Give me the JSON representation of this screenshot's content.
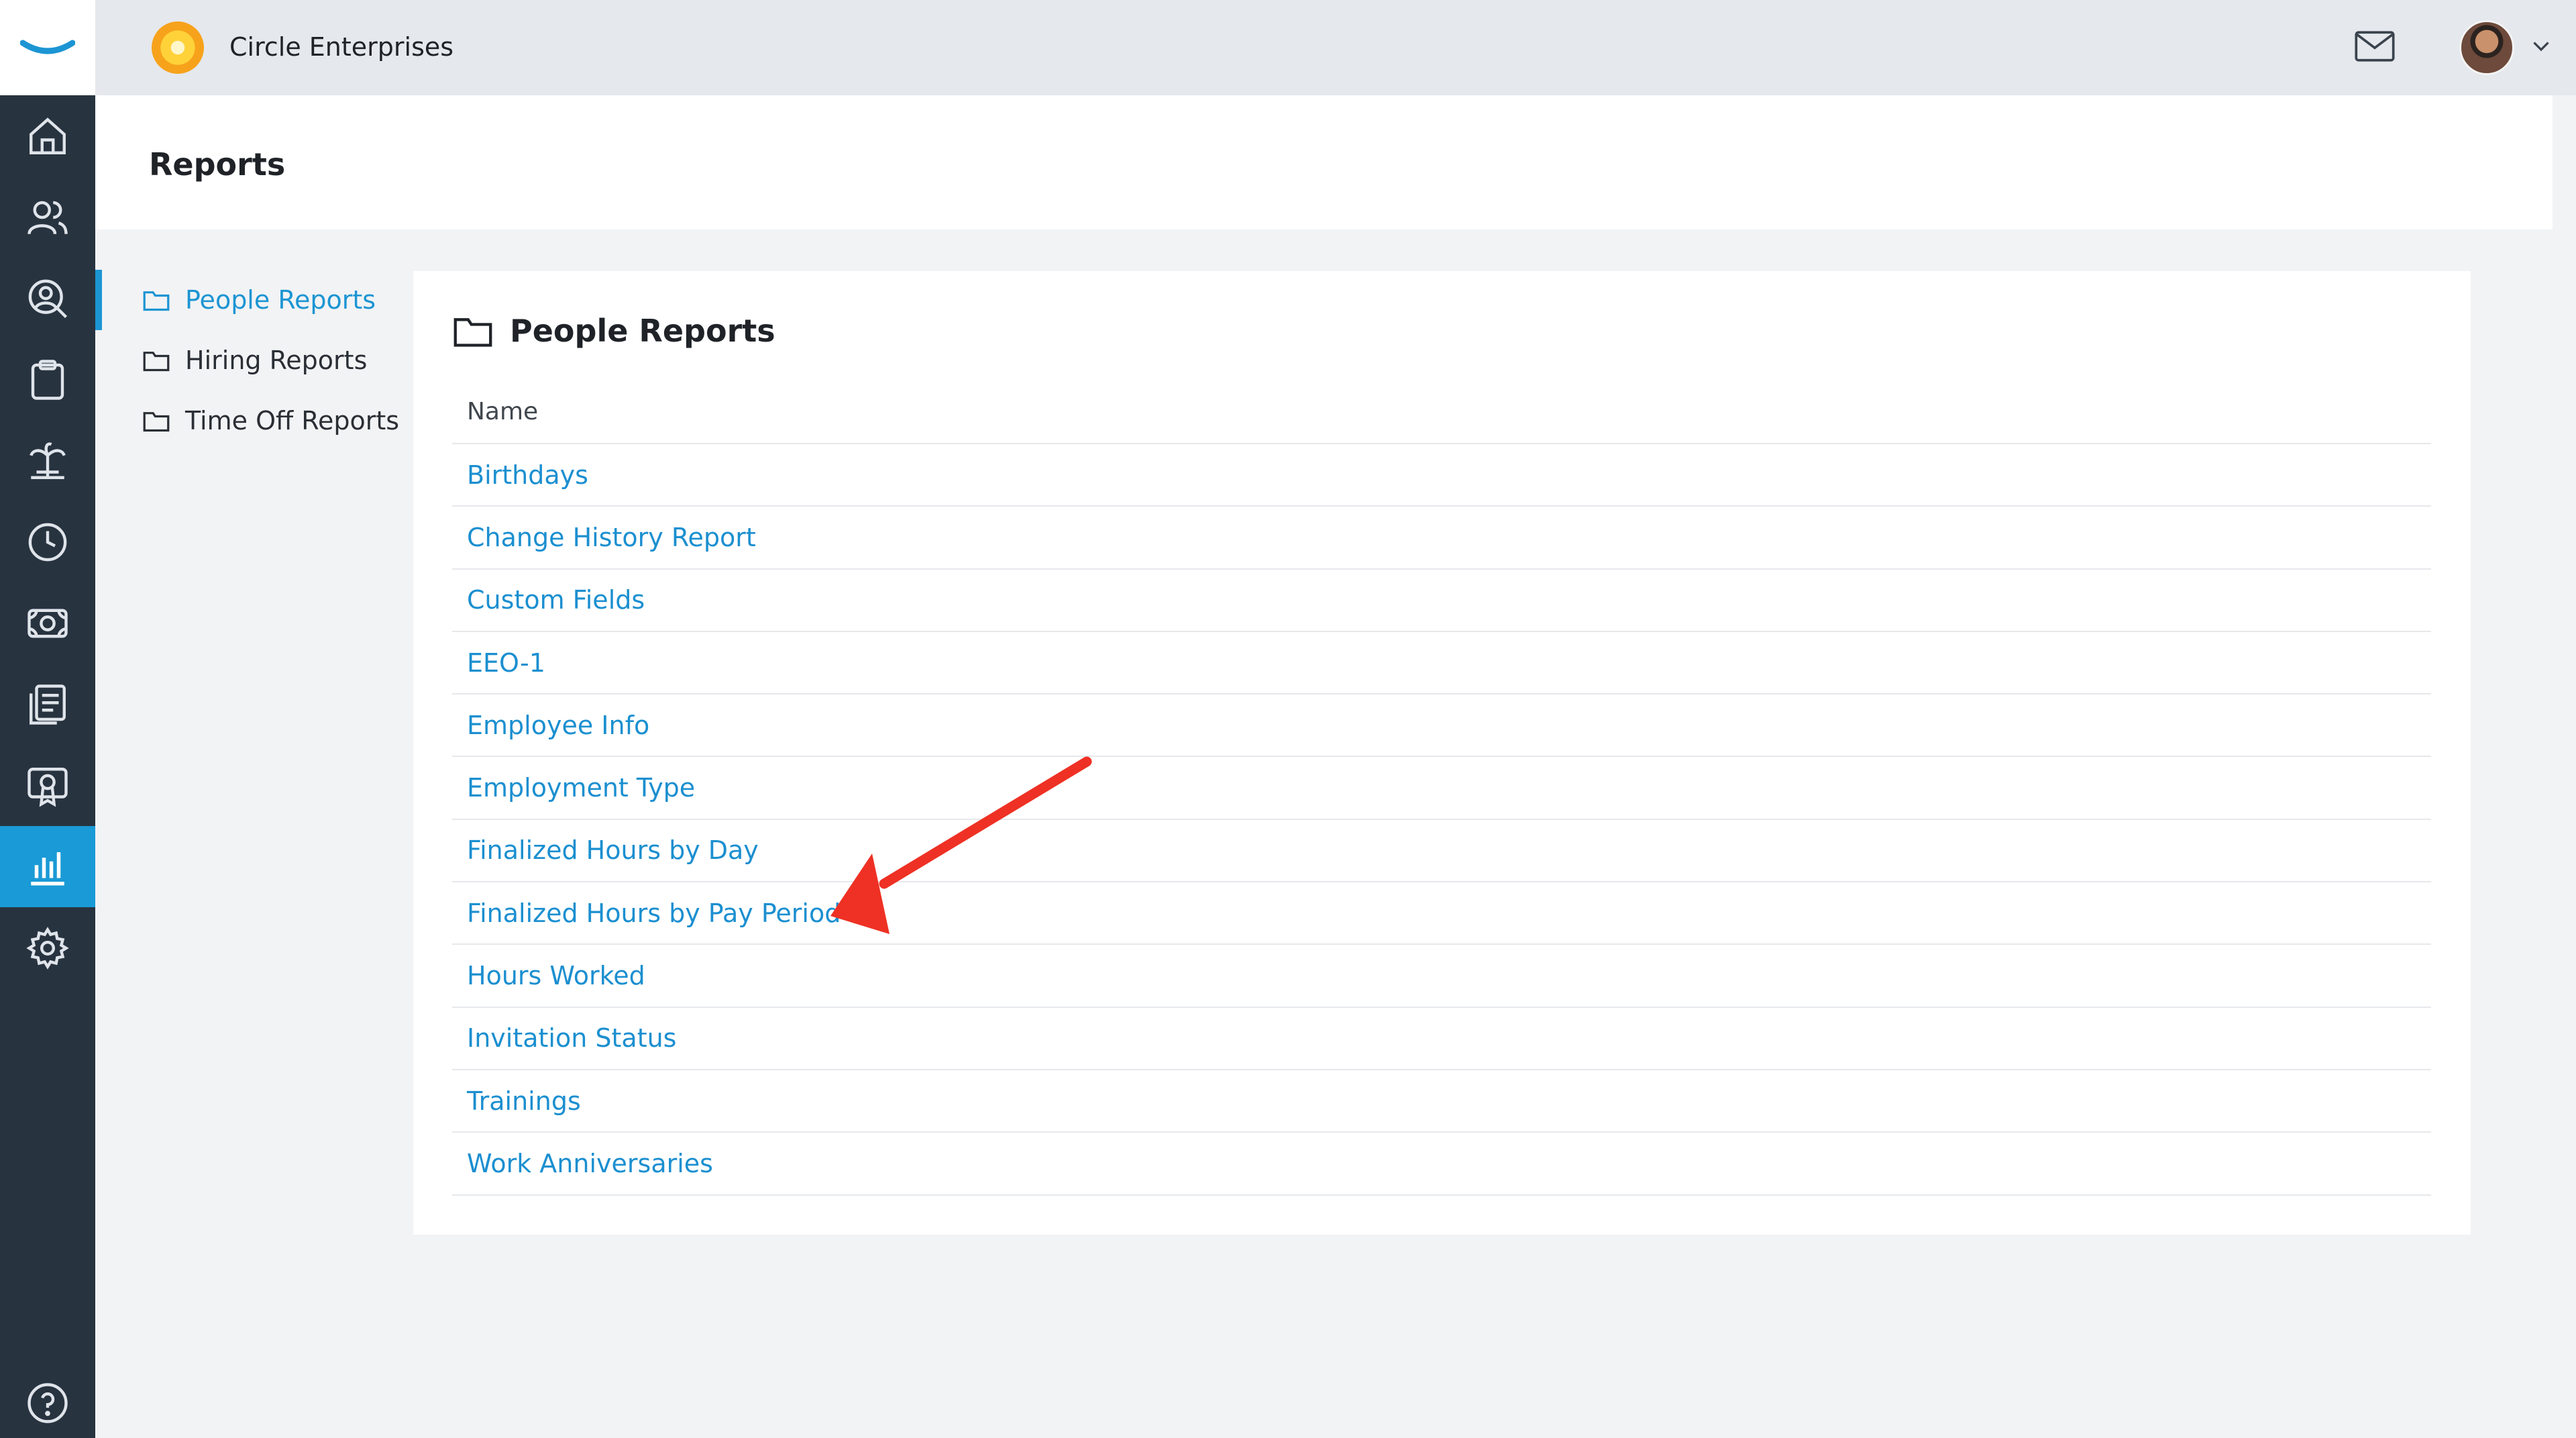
{
  "app": {
    "company_name": "Circle Enterprises",
    "accent_color": "#1c95d3"
  },
  "rail": {
    "items": [
      {
        "icon": "home-icon"
      },
      {
        "icon": "people-icon"
      },
      {
        "icon": "user-search-icon"
      },
      {
        "icon": "clipboard-icon"
      },
      {
        "icon": "vacation-icon"
      },
      {
        "icon": "clock-icon"
      },
      {
        "icon": "money-icon"
      },
      {
        "icon": "documents-icon"
      },
      {
        "icon": "certificate-icon"
      },
      {
        "icon": "reports-chart-icon",
        "active": true
      },
      {
        "icon": "gear-icon"
      }
    ],
    "help_icon": "help-circle-icon"
  },
  "header": {
    "title": "Reports"
  },
  "left_nav": {
    "items": [
      {
        "label": "People Reports",
        "active": true
      },
      {
        "label": "Hiring Reports"
      },
      {
        "label": "Time Off Reports"
      }
    ]
  },
  "main": {
    "title": "People Reports",
    "column_header": "Name",
    "rows": [
      "Birthdays",
      "Change History Report",
      "Custom Fields",
      "EEO-1",
      "Employee Info",
      "Employment Type",
      "Finalized Hours by Day",
      "Finalized Hours by Pay Period",
      "Hours Worked",
      "Invitation Status",
      "Trainings",
      "Work Anniversaries"
    ]
  },
  "annotation": {
    "arrow_color": "#ee3124"
  }
}
